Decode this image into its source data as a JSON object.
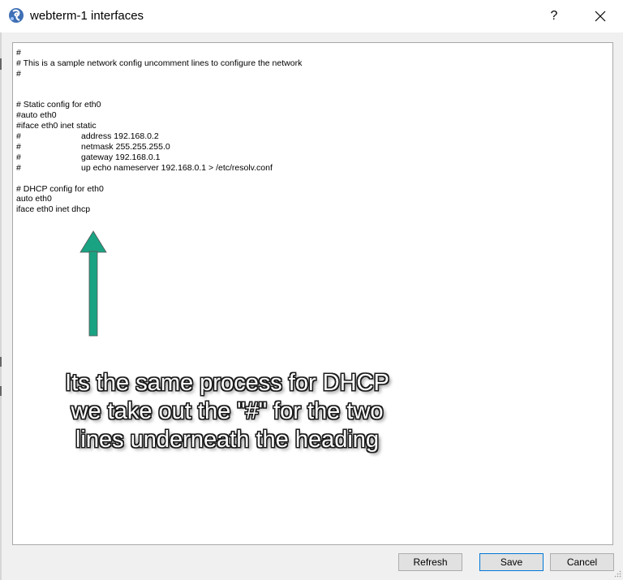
{
  "window": {
    "title": "webterm-1 interfaces",
    "help_label": "?"
  },
  "editor": {
    "lines": [
      {
        "text": "#"
      },
      {
        "text": "# This is a sample network config uncomment lines to configure the network"
      },
      {
        "text": "#"
      },
      {
        "text": ""
      },
      {
        "text": ""
      },
      {
        "text": "# Static config for eth0"
      },
      {
        "text": "#auto eth0"
      },
      {
        "text": "#iface eth0 inet static"
      },
      {
        "text": "#",
        "indent": "address 192.168.0.2"
      },
      {
        "text": "#",
        "indent": "netmask 255.255.255.0"
      },
      {
        "text": "#",
        "indent": "gateway 192.168.0.1"
      },
      {
        "text": "#",
        "indent": "up echo nameserver 192.168.0.1 > /etc/resolv.conf"
      },
      {
        "text": ""
      },
      {
        "text": "# DHCP config for eth0"
      },
      {
        "text": "auto eth0"
      },
      {
        "text": "iface eth0 inet dhcp"
      }
    ]
  },
  "annotation": {
    "lines": [
      "Its the same process for DHCP",
      "we take out the \"#\" for the two",
      "lines underneath the heading"
    ],
    "arrow_color": "#1aa383"
  },
  "buttons": {
    "refresh": "Refresh",
    "save": "Save",
    "cancel": "Cancel"
  },
  "colors": {
    "accent": "#0078d7"
  }
}
